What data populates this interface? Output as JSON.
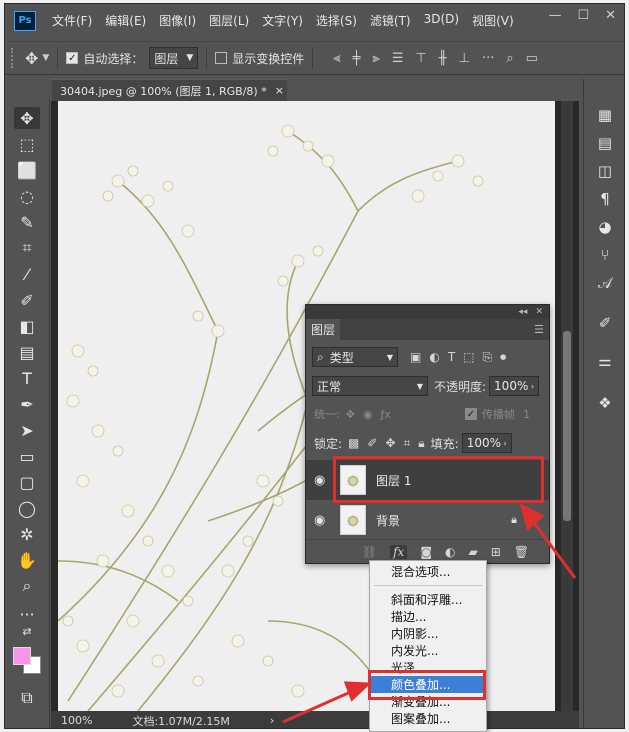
{
  "app": {
    "logo": "Ps"
  },
  "menubar": {
    "items": [
      "文件(F)",
      "编辑(E)",
      "图像(I)",
      "图层(L)",
      "文字(Y)",
      "选择(S)",
      "滤镜(T)",
      "3D(D)",
      "视图(V)"
    ],
    "window_controls": [
      "minimize-icon",
      "maximize-icon",
      "close-icon"
    ]
  },
  "options": {
    "auto_select_label": "自动选择：",
    "auto_select_checked": true,
    "auto_select_value": "图层",
    "show_transform_label": "显示变换控件",
    "show_transform_checked": false
  },
  "document": {
    "tab_title": "30404.jpeg @ 100% (图层 1, RGB/8) *",
    "close_glyph": "×"
  },
  "status": {
    "zoom": "100%",
    "doc_info": "文档:1.07M/2.15M",
    "arrow": "›"
  },
  "colors": {
    "foreground": "#f596e6",
    "background": "#ffffff",
    "highlight_menu": "#3c7fd7",
    "annotation_red": "#e02f2f"
  },
  "layers_panel": {
    "tab": "图层",
    "filter_type": "类型",
    "blend_mode": "正常",
    "opacity_label": "不透明度:",
    "opacity_value": "100%",
    "unify_label": "统一:",
    "propagate_label": "传播帧",
    "propagate_value": "1",
    "lock_label": "锁定:",
    "fill_label": "填充:",
    "fill_value": "100%",
    "layers": [
      {
        "name": "图层 1",
        "selected": true,
        "visible": true
      },
      {
        "name": "背景",
        "selected": false,
        "visible": true,
        "locked": true
      }
    ]
  },
  "fx_menu": {
    "items": [
      "混合选项...",
      "斜面和浮雕...",
      "描边...",
      "内阴影...",
      "内发光...",
      "光泽...",
      "颜色叠加...",
      "渐变叠加...",
      "图案叠加..."
    ],
    "highlighted": "颜色叠加..."
  }
}
